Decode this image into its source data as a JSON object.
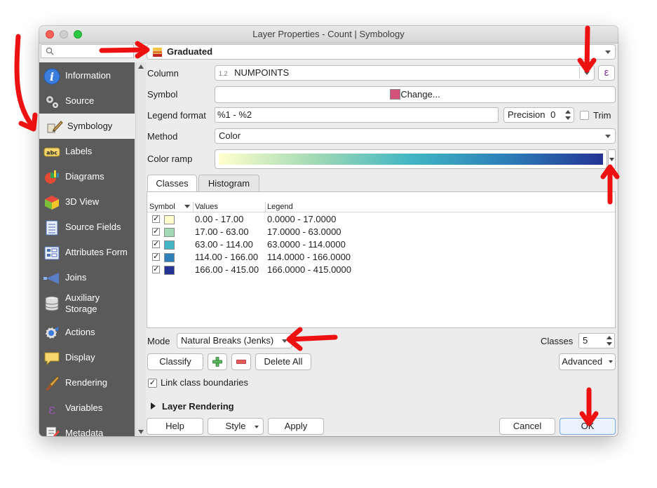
{
  "window": {
    "title": "Layer Properties - Count | Symbology"
  },
  "renderer": {
    "selected": "Graduated"
  },
  "sidebar": {
    "items": [
      {
        "label": "Information",
        "icon": "info-icon"
      },
      {
        "label": "Source",
        "icon": "source-icon"
      },
      {
        "label": "Symbology",
        "icon": "symbology-icon"
      },
      {
        "label": "Labels",
        "icon": "labels-icon"
      },
      {
        "label": "Diagrams",
        "icon": "diagrams-icon"
      },
      {
        "label": "3D View",
        "icon": "3d-view-icon"
      },
      {
        "label": "Source Fields",
        "icon": "source-fields-icon"
      },
      {
        "label": "Attributes Form",
        "icon": "attributes-form-icon"
      },
      {
        "label": "Joins",
        "icon": "joins-icon"
      },
      {
        "label": "Auxiliary",
        "label2": "Storage",
        "icon": "auxiliary-storage-icon"
      },
      {
        "label": "Actions",
        "icon": "actions-icon"
      },
      {
        "label": "Display",
        "icon": "display-icon"
      },
      {
        "label": "Rendering",
        "icon": "rendering-icon"
      },
      {
        "label": "Variables",
        "icon": "variables-icon"
      },
      {
        "label": "Metadata",
        "icon": "metadata-icon"
      }
    ],
    "active_index": 2
  },
  "form": {
    "column_label": "Column",
    "column_type_badge": "1.2",
    "column_value": "NUMPOINTS",
    "expression_symbol": "ε",
    "symbol_label": "Symbol",
    "symbol_button": "Change...",
    "symbol_color": "#d4527a",
    "legend_format_label": "Legend format",
    "legend_format_value": "%1 - %2",
    "precision_label": "Precision",
    "precision_value": "0",
    "trim_label": "Trim",
    "method_label": "Method",
    "method_value": "Color",
    "color_ramp_label": "Color ramp",
    "color_ramp_colors": [
      "#ffffcc",
      "#a1dab4",
      "#41b6c4",
      "#2c7fb8",
      "#253494"
    ]
  },
  "tabs": [
    {
      "label": "Classes",
      "active": true
    },
    {
      "label": "Histogram",
      "active": false
    }
  ],
  "classes_table": {
    "headers": [
      "Symbol",
      "Values",
      "Legend"
    ],
    "rows": [
      {
        "checked": true,
        "color": "#ffffcc",
        "values": "0.00 - 17.00",
        "legend": "0.0000 - 17.0000"
      },
      {
        "checked": true,
        "color": "#a1dab4",
        "values": "17.00 - 63.00",
        "legend": "17.0000 - 63.0000"
      },
      {
        "checked": true,
        "color": "#41b6c4",
        "values": "63.00 - 114.00",
        "legend": "63.0000 - 114.0000"
      },
      {
        "checked": true,
        "color": "#2c7fb8",
        "values": "114.00 - 166.00",
        "legend": "114.0000 - 166.0000"
      },
      {
        "checked": true,
        "color": "#253494",
        "values": "166.00 - 415.00",
        "legend": "166.0000 - 415.0000"
      }
    ]
  },
  "mode": {
    "label": "Mode",
    "value": "Natural Breaks (Jenks)"
  },
  "classes_count": {
    "label": "Classes",
    "value": "5"
  },
  "actions": {
    "classify": "Classify",
    "add": "+",
    "remove": "−",
    "delete_all": "Delete All",
    "advanced": "Advanced",
    "link_boundaries": "Link class boundaries",
    "link_boundaries_checked": true,
    "layer_rendering": "Layer Rendering"
  },
  "footer": {
    "help": "Help",
    "style": "Style",
    "apply": "Apply",
    "cancel": "Cancel",
    "ok": "OK"
  },
  "annotation_color": "#ee1111"
}
